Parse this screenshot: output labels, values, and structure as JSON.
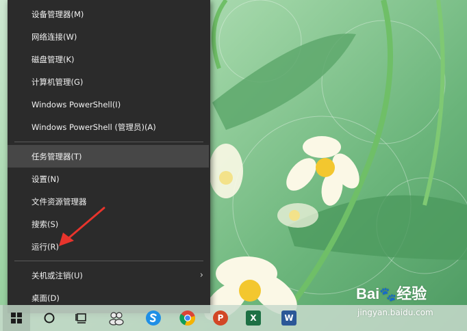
{
  "menu": {
    "items": [
      {
        "label": "设备管理器(M)"
      },
      {
        "label": "网络连接(W)"
      },
      {
        "label": "磁盘管理(K)"
      },
      {
        "label": "计算机管理(G)"
      },
      {
        "label": "Windows PowerShell(I)"
      },
      {
        "label": "Windows PowerShell (管理员)(A)"
      },
      {
        "label": "任务管理器(T)",
        "highlighted": true
      },
      {
        "label": "设置(N)"
      },
      {
        "label": "文件资源管理器"
      },
      {
        "label": "搜索(S)"
      },
      {
        "label": "运行(R)"
      },
      {
        "label": "关机或注销(U)",
        "has_submenu": true
      },
      {
        "label": "桌面(D)"
      }
    ]
  },
  "taskbar": {
    "icons": [
      "windows-start-icon",
      "cortana-search-icon",
      "task-view-icon",
      "people-icon",
      "sogou-browser-icon",
      "chrome-icon",
      "powerpoint-icon",
      "excel-icon",
      "word-icon"
    ],
    "powerpoint_letter": "P",
    "excel_letter": "X",
    "word_letter": "W"
  },
  "watermark": {
    "brand": "Bai",
    "brand_cn": "经验",
    "url": "jingyan.baidu.com"
  },
  "colors": {
    "menu_bg": "#2b2b2b",
    "menu_highlight": "#474747",
    "annotation_arrow": "#e8342c"
  }
}
